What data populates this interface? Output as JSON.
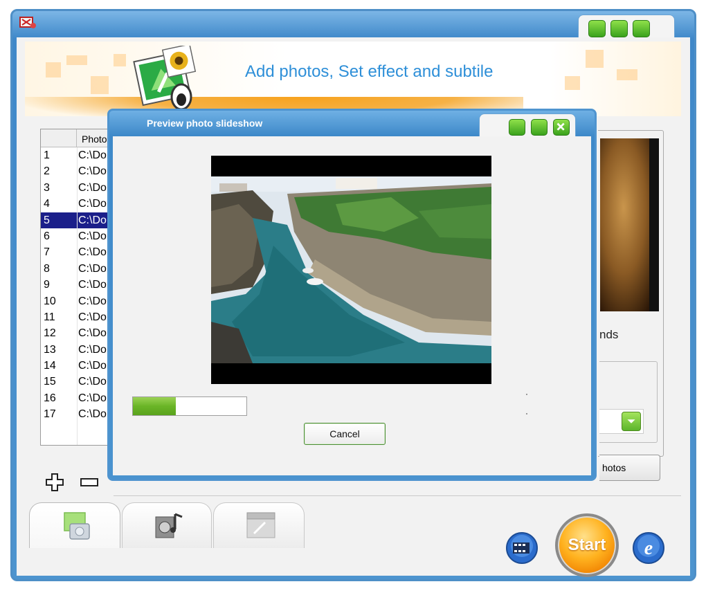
{
  "window": {
    "title": "",
    "controls": [
      "minimize",
      "maximize",
      "close"
    ]
  },
  "header": {
    "title": "Add photos, Set effect and subtile"
  },
  "photo_list": {
    "column_header": "Photo",
    "rows": [
      {
        "num": "1",
        "path": "C:\\Do"
      },
      {
        "num": "2",
        "path": "C:\\Do"
      },
      {
        "num": "3",
        "path": "C:\\Do"
      },
      {
        "num": "4",
        "path": "C:\\Do"
      },
      {
        "num": "5",
        "path": "C:\\Do"
      },
      {
        "num": "6",
        "path": "C:\\Do"
      },
      {
        "num": "7",
        "path": "C:\\Do"
      },
      {
        "num": "8",
        "path": "C:\\Do"
      },
      {
        "num": "9",
        "path": "C:\\Do"
      },
      {
        "num": "10",
        "path": "C:\\Do"
      },
      {
        "num": "11",
        "path": "C:\\Do"
      },
      {
        "num": "12",
        "path": "C:\\Do"
      },
      {
        "num": "13",
        "path": "C:\\Do"
      },
      {
        "num": "14",
        "path": "C:\\Do"
      },
      {
        "num": "15",
        "path": "C:\\Do"
      },
      {
        "num": "16",
        "path": "C:\\Do"
      },
      {
        "num": "17",
        "path": "C:\\Do"
      }
    ],
    "selected_row": "5"
  },
  "right_panel": {
    "text_fragment": "nds",
    "button_fragment": "hotos"
  },
  "tabs": [
    {
      "name": "photos-tab",
      "icon": "photo-icon",
      "active": true
    },
    {
      "name": "music-tab",
      "icon": "music-icon",
      "active": false
    },
    {
      "name": "output-tab",
      "icon": "clapboard-icon",
      "active": false
    }
  ],
  "actions": {
    "start_label": "Start",
    "film_icon": "film-icon",
    "ie_icon": "internet-explorer-icon"
  },
  "preview": {
    "title": "Preview photo slideshow",
    "progress": 0.38,
    "cancel_label": "Cancel"
  },
  "colors": {
    "window_blue": "#4e8fc7",
    "button_green": "#6ab527",
    "header_text": "#2e8fd8",
    "selection": "#1b1f8a",
    "start_orange": "#ffb21f"
  }
}
